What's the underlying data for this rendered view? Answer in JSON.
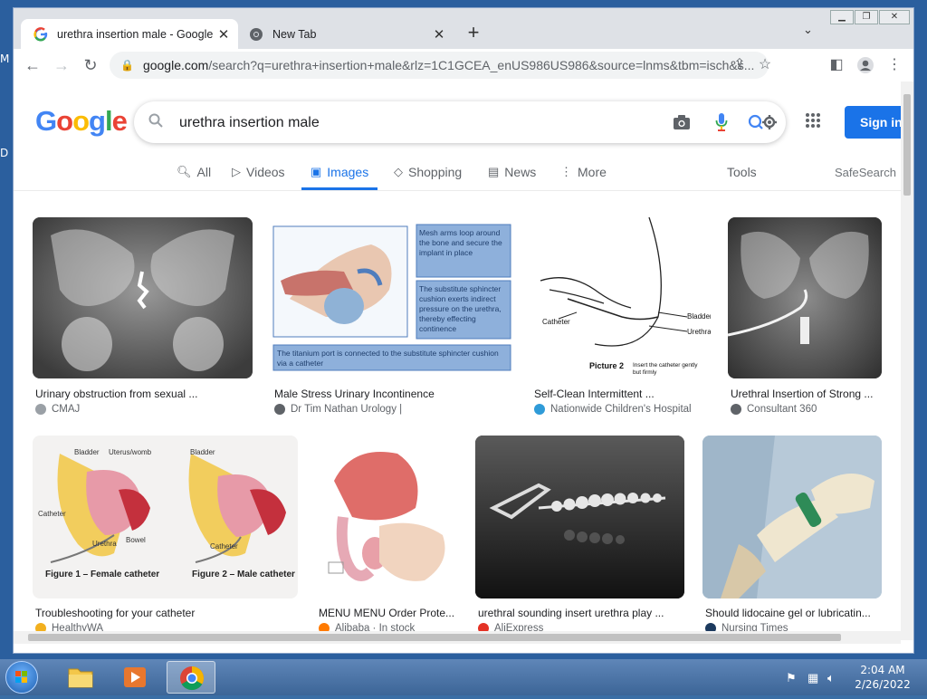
{
  "desktop": {
    "left_letters": [
      "M",
      "D"
    ]
  },
  "browser": {
    "tabs": [
      {
        "title": "urethra insertion male - Google S",
        "active": true
      },
      {
        "title": "New Tab",
        "active": false
      }
    ],
    "new_tab_glyph": "+",
    "url_host": "google.com",
    "url_rest": "/search?q=urethra+insertion+male&rlz=1C1GCEA_enUS986US986&source=lnms&tbm=isch&s...",
    "window_controls": [
      "minimize",
      "restore",
      "close"
    ]
  },
  "google": {
    "logo": [
      {
        "ch": "G",
        "color": "#4285F4"
      },
      {
        "ch": "o",
        "color": "#EA4335"
      },
      {
        "ch": "o",
        "color": "#FBBC05"
      },
      {
        "ch": "g",
        "color": "#4285F4"
      },
      {
        "ch": "l",
        "color": "#34A853"
      },
      {
        "ch": "e",
        "color": "#EA4335"
      }
    ],
    "query": "urethra insertion male",
    "signin_label": "Sign in",
    "nav": {
      "all": "All",
      "videos": "Videos",
      "images": "Images",
      "shopping": "Shopping",
      "news": "News",
      "more": "More",
      "tools": "Tools",
      "safesearch": "SafeSearch"
    },
    "results": [
      {
        "caption": "Urinary obstruction from sexual ...",
        "source": "CMAJ",
        "icon_color": "#9aa0a6"
      },
      {
        "caption": "Male Stress Urinary Incontinence",
        "source": "Dr Tim Nathan Urology |",
        "icon_color": "#5f6368"
      },
      {
        "caption": "Self-Clean Intermittent ...",
        "source": "Nationwide Children's Hospital",
        "icon_color": "#2f9bd8"
      },
      {
        "caption": "Urethral Insertion of Strong ...",
        "source": "Consultant 360",
        "icon_color": "#5f6368"
      },
      {
        "caption": "Troubleshooting for your catheter",
        "source": "HealthyWA",
        "icon_color": "#f2b01e"
      },
      {
        "caption": "MENU MENU Order Prote...",
        "source": "Alibaba · In stock",
        "icon_color": "#ff7a00"
      },
      {
        "caption": "urethral sounding insert urethra play ...",
        "source": "AliExpress",
        "icon_color": "#e43225"
      },
      {
        "caption": "Should lidocaine gel or lubricatin...",
        "source": "Nursing Times",
        "icon_color": "#1c3a5e"
      }
    ],
    "image_text": {
      "mesh": "Mesh arms loop around the bone and secure the implant in place",
      "sphincter": "The substitute sphincter cushion exerts indirect pressure on the urethra, thereby effecting continence",
      "port": "The titanium port is connected to the substitute sphincter cushion via a catheter",
      "catheter": "Catheter",
      "bladder": "Bladder",
      "urethra": "Urethra",
      "picture2": "Picture 2",
      "picture2_sub": "Insert the catheter gently but firmly",
      "uterus": "Uterus/womb",
      "bowel": "Bowel",
      "fig1": "Figure 1 – Female catheter",
      "fig2": "Figure 2 – Male catheter"
    }
  },
  "taskbar": {
    "time": "2:04 AM",
    "date": "2/26/2022"
  }
}
